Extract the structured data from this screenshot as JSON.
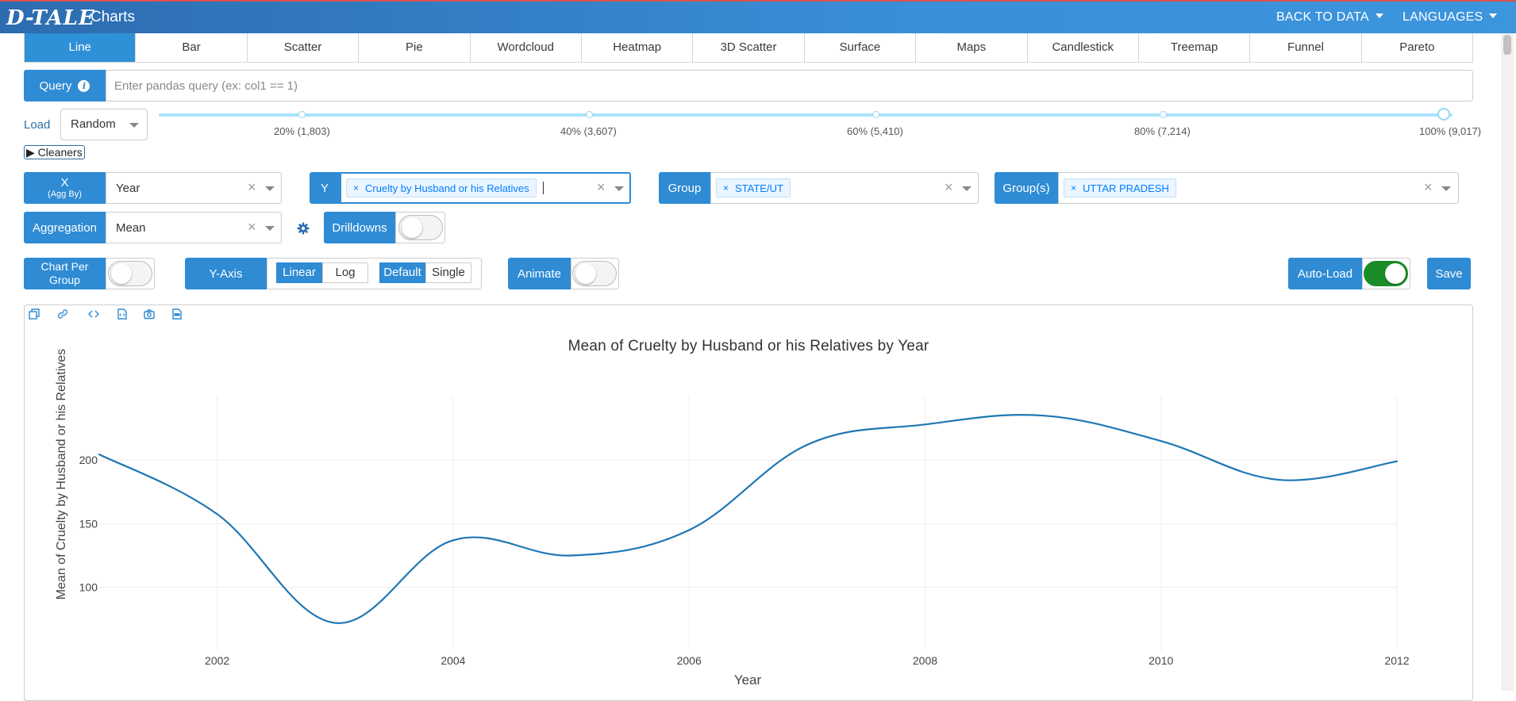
{
  "header": {
    "logo": "D-TALE",
    "title": "Charts",
    "back_to_data": "BACK TO DATA",
    "languages": "LANGUAGES"
  },
  "tabs": [
    "Line",
    "Bar",
    "Scatter",
    "Pie",
    "Wordcloud",
    "Heatmap",
    "3D Scatter",
    "Surface",
    "Maps",
    "Candlestick",
    "Treemap",
    "Funnel",
    "Pareto"
  ],
  "active_tab": "Line",
  "query": {
    "label": "Query",
    "placeholder": "Enter pandas query (ex: col1 == 1)",
    "value": ""
  },
  "load": {
    "label": "Load",
    "selected": "Random",
    "marks": [
      "20% (1,803)",
      "40% (3,607)",
      "60% (5,410)",
      "80% (7,214)",
      "100% (9,017)"
    ],
    "value_percent": 100
  },
  "cleaners": "Cleaners",
  "x": {
    "label": "X",
    "sublabel": "(Agg By)",
    "value": "Year"
  },
  "y": {
    "label": "Y",
    "chips": [
      "Cruelty by Husband or his Relatives"
    ]
  },
  "group": {
    "label": "Group",
    "chips": [
      "STATE/UT"
    ]
  },
  "groups": {
    "label": "Group(s)",
    "chips": [
      "UTTAR PRADESH"
    ]
  },
  "aggregation": {
    "label": "Aggregation",
    "value": "Mean"
  },
  "drilldowns": {
    "label": "Drilldowns",
    "on": false
  },
  "chart_per_group": {
    "label": "Chart Per Group",
    "on": false
  },
  "y_axis": {
    "label": "Y-Axis",
    "scale_options": [
      "Linear",
      "Log"
    ],
    "scale_selected": "Linear",
    "mode_options": [
      "Default",
      "Single"
    ],
    "mode_selected": "Default"
  },
  "animate": {
    "label": "Animate",
    "on": false
  },
  "auto_load": {
    "label": "Auto-Load",
    "on": true
  },
  "save": "Save",
  "colors": {
    "accent": "#2e8bd4",
    "line": "#1f77b4",
    "toggle_on": "#1a8c28",
    "header": "#3a8fd8"
  },
  "chart_data": {
    "type": "line",
    "title": "Mean of Cruelty by Husband or his Relatives by Year",
    "xlabel": "Year",
    "ylabel": "Mean of Cruelty by Husband or his Relatives",
    "x": [
      2001,
      2002,
      2003,
      2004,
      2005,
      2006,
      2007,
      2008,
      2009,
      2010,
      2011,
      2012
    ],
    "series": [
      {
        "values": [
          204.5,
          157.5,
          72,
          137,
          125,
          145,
          212,
          228,
          235,
          215,
          184.5,
          199
        ]
      }
    ],
    "xlim": [
      2001,
      2012
    ],
    "ylim": [
      63,
      250
    ],
    "x_ticks": [
      "2002",
      "2004",
      "2006",
      "2008",
      "2010",
      "2012"
    ],
    "y_ticks": [
      "100",
      "150",
      "200"
    ],
    "grid": true
  }
}
